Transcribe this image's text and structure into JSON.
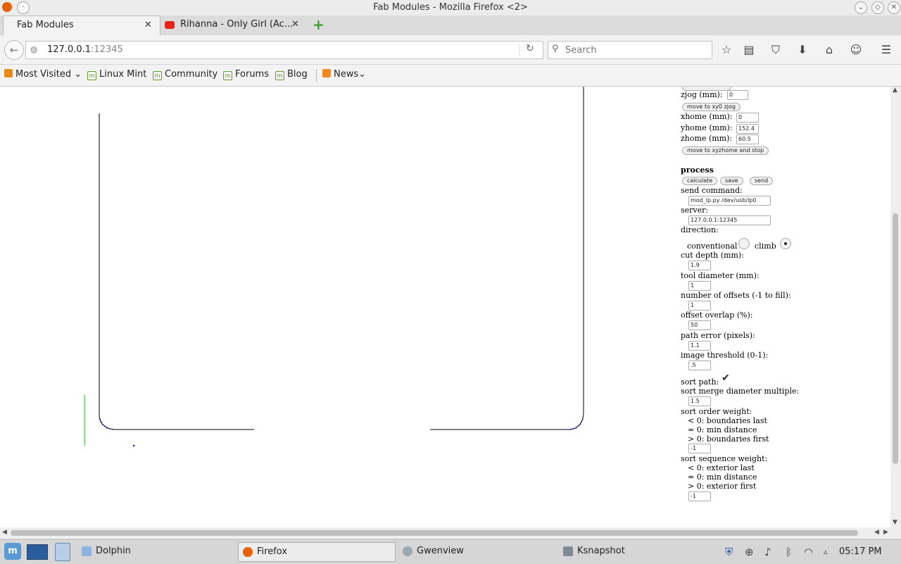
{
  "window": {
    "title": "Fab Modules - Mozilla Firefox <2>"
  },
  "tabs": [
    {
      "label": "Fab Modules",
      "active": true
    },
    {
      "label": "Rihanna - Only Girl (Ac...",
      "active": false
    }
  ],
  "navbar": {
    "url_host": "127.0.0.1",
    "url_port": ":12345",
    "search_placeholder": "Search"
  },
  "bookmarks": [
    {
      "label": "Most Visited",
      "dropdown": true
    },
    {
      "label": "Linux Mint"
    },
    {
      "label": "Community"
    },
    {
      "label": "Forums"
    },
    {
      "label": "Blog"
    },
    {
      "label": "News",
      "dropdown": true
    }
  ],
  "form": {
    "zjog_label": "zjog (mm):",
    "zjog_value": "0",
    "move_xy0_zjog": "move to xy0 zjog",
    "xhome_label": "xhome (mm):",
    "xhome_value": "0",
    "yhome_label": "yhome (mm):",
    "yhome_value": "152.4",
    "zhome_label": "zhome (mm):",
    "zhome_value": "60.5",
    "move_xyzhome": "move to xyzhome and stop",
    "process_heading": "process",
    "calculate": "calculate",
    "save": "save",
    "send": "send",
    "send_command_label": "send command:",
    "send_command_value": "mod_lp.py /dev/usb/lp0",
    "server_label": "server:",
    "server_value": "127.0.0.1:12345",
    "direction_label": "direction:",
    "conventional": "conventional",
    "climb": "climb",
    "direction_selected": "climb",
    "cut_depth_label": "cut depth (mm):",
    "cut_depth_value": "1.9",
    "tool_diameter_label": "tool diameter (mm):",
    "tool_diameter_value": "1",
    "offsets_label": "number of offsets (-1 to fill):",
    "offsets_value": "1",
    "overlap_label": "offset overlap (%):",
    "overlap_value": "50",
    "path_error_label": "path error (pixels):",
    "path_error_value": "1.1",
    "threshold_label": "image threshold (0-1):",
    "threshold_value": ".5",
    "sort_path_label": "sort path:",
    "sort_path_checked": true,
    "sort_merge_label": "sort merge diameter multiple:",
    "sort_merge_value": "1.5",
    "sort_order_label": "sort order weight:",
    "sort_order_opt1": "< 0: boundaries last",
    "sort_order_opt2": "= 0: min distance",
    "sort_order_opt3": "> 0: boundaries first",
    "sort_order_value": "-1",
    "sort_seq_label": "sort sequence weight:",
    "sort_seq_opt1": "< 0: exterior last",
    "sort_seq_opt2": "= 0: min distance",
    "sort_seq_opt3": "> 0: exterior first",
    "sort_seq_value": "-1"
  },
  "taskbar": {
    "items": [
      {
        "label": "Dolphin"
      },
      {
        "label": "Firefox",
        "active": true
      },
      {
        "label": "Gwenview"
      },
      {
        "label": "Ksnapshot"
      }
    ],
    "clock": "05:17 PM"
  },
  "colors": {
    "path_line": "#000000",
    "path_dots": "#0000cc",
    "axis_green": "#00cc00"
  }
}
